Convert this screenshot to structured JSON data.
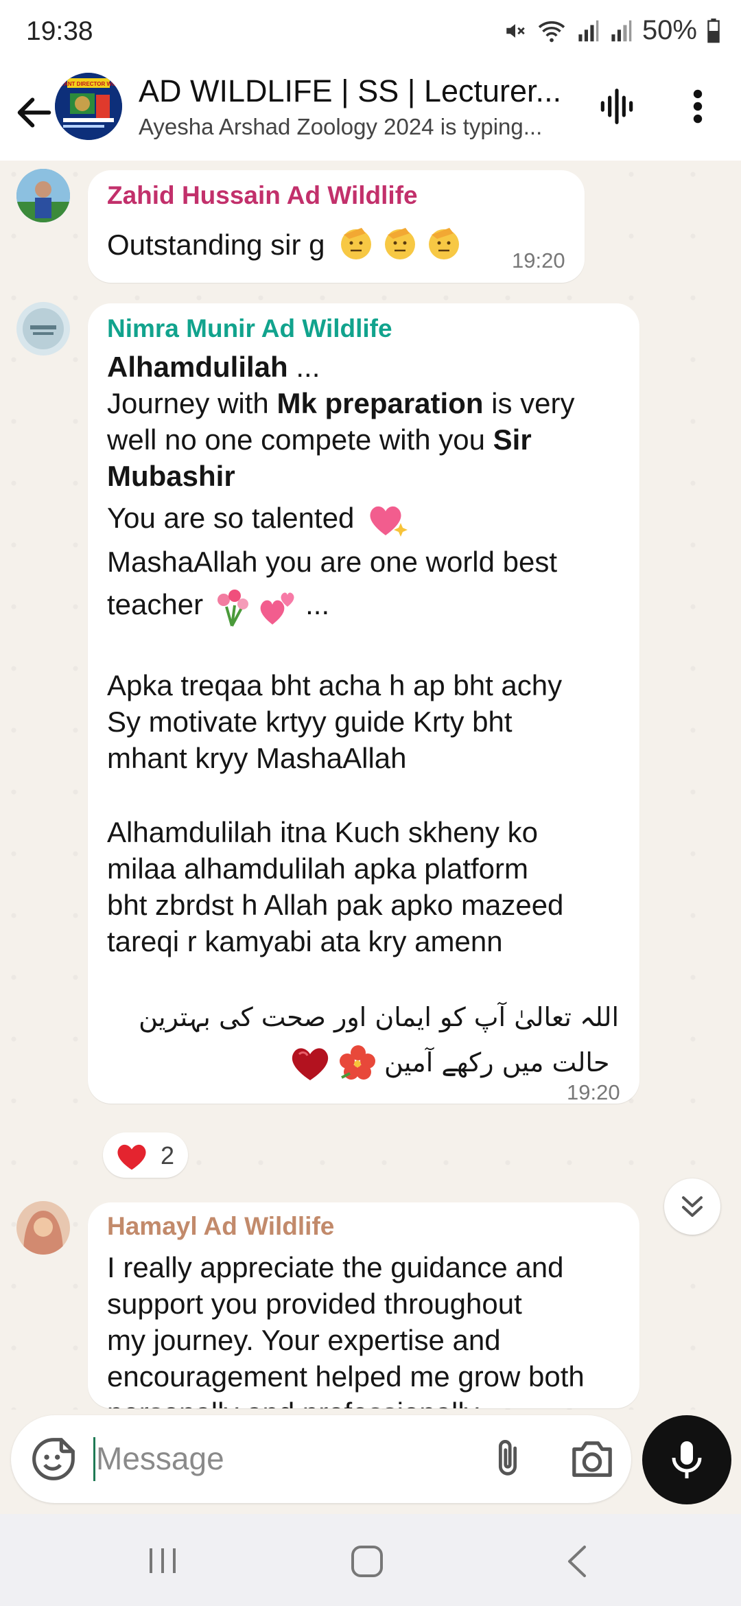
{
  "status_bar": {
    "time": "19:38",
    "battery": "50%",
    "icons": [
      "mute-icon",
      "wifi-icon",
      "signal-icon",
      "signal-icon",
      "battery-icon"
    ]
  },
  "header": {
    "title": "AD WILDLIFE | SS | Lecturer...",
    "subtitle": "Ayesha Arshad Zoology 2024 is typing...",
    "avatar_text": "ASSISTANT DIRECTOR WILDLIFE"
  },
  "colors": {
    "sender1": "#c2306b",
    "sender2": "#11a38d",
    "sender3": "#c28a6b",
    "header_bg": "#ffffff",
    "chat_bg": "#f5f1eb"
  },
  "messages": {
    "m1": {
      "sender": "Zahid Hussain Ad Wildlife",
      "text": "Outstanding sir g",
      "time": "19:20"
    },
    "m2": {
      "sender": "Nimra Munir Ad Wildlife",
      "l1a": "Alhamdulilah",
      "l1b": " ...",
      "l2a": "Journey with ",
      "l2b": "Mk preparation",
      "l2c": " is very",
      "l3a": "well no one compete with you ",
      "l3b": "Sir",
      "l4": "Mubashir",
      "l5": "You are so talented",
      "l6": "MashaAllah you are one world best",
      "l7a": "teacher",
      "l7b": "...",
      "l8": "Apka treqaa bht acha h ap bht achy",
      "l9": "Sy motivate krtyy guide Krty bht",
      "l10": "mhant kryy MashaAllah",
      "l11": "Alhamdulilah itna Kuch skheny ko",
      "l12": "milaa alhamdulilah apka platform",
      "l13": "bht zbrdst h Allah pak apko mazeed",
      "l14": "tareqi r kamyabi ata kry amenn",
      "urdu1": "اللہ تعالیٰ آپ کو ایمان اور صحت کی بہترین",
      "urdu2": "حالت میں رکھے آمین",
      "time": "19:20",
      "reaction_count": "2"
    },
    "m3": {
      "sender": "Hamayl Ad Wildlife",
      "l1": "I really appreciate the guidance and",
      "l2": "support you provided throughout",
      "l3": "my journey. Your expertise and",
      "l4": "encouragement helped me grow both",
      "l5": "personally and professionally."
    }
  },
  "input": {
    "placeholder": "Message"
  }
}
